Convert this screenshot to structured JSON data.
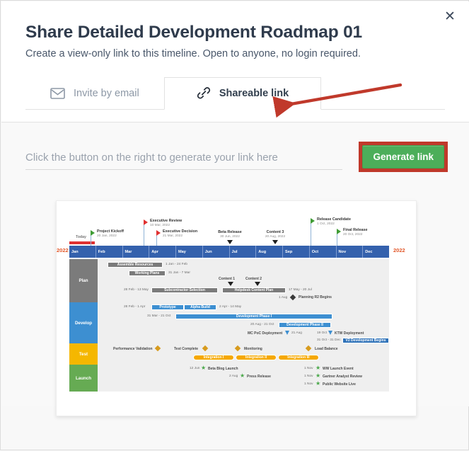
{
  "dialog": {
    "title": "Share Detailed Development Roadmap 01",
    "subtitle": "Create a view-only link to this timeline. Open to anyone, no login required.",
    "close_label": "✕"
  },
  "tabs": [
    {
      "label": "Invite by email",
      "icon": "envelope-icon",
      "active": false
    },
    {
      "label": "Shareable link",
      "icon": "link-chain-icon",
      "active": true
    }
  ],
  "share": {
    "input_value": "",
    "input_placeholder": "Click the button on the right to generate your link here",
    "generate_label": "Generate link",
    "generate_color": "#4cae5a",
    "highlight_color": "#c0392b"
  },
  "timeline": {
    "year_left": "2022",
    "year_right": "2022",
    "today_label": "Today",
    "months": [
      "Jan",
      "Feb",
      "Mar",
      "Apr",
      "May",
      "Jun",
      "Jul",
      "Aug",
      "Sep",
      "Oct",
      "Nov",
      "Dec"
    ],
    "milestones": [
      {
        "name": "Project Kickoff",
        "date": "20 Jan, 2022",
        "marker": "flag-green"
      },
      {
        "name": "Executive Review",
        "date": "10 Mar, 2022",
        "marker": "flag-red"
      },
      {
        "name": "Executive Decision",
        "date": "21 Mar, 2022",
        "marker": "flag-red"
      },
      {
        "name": "Beta Release",
        "date": "30 Jun, 2022",
        "marker": "triangle-black"
      },
      {
        "name": "Content 3",
        "date": "20 Aug, 2022",
        "marker": "triangle-black"
      },
      {
        "name": "Release Candidate",
        "date": "1 Oct, 2022",
        "marker": "flag-green"
      },
      {
        "name": "Final Release",
        "date": "20 Oct, 2022",
        "marker": "flag-green"
      }
    ],
    "lanes": [
      {
        "name": "Plan",
        "color": "#7b7b7b",
        "bars": [
          {
            "label": "Assemble Resources",
            "dates": "1 Jan - 24 Feb"
          },
          {
            "label": "Working Plans",
            "dates": "31 Jan - 7 Mar"
          },
          {
            "label": "Subcontractor Selection",
            "dates": "28 Feb - 13 May"
          },
          {
            "label": "Helpdesk Content Plan",
            "dates": "17 May - 20 Jul"
          }
        ],
        "markers": [
          {
            "label": "Content 1"
          },
          {
            "label": "Content 2"
          },
          {
            "label": "Planning R2 Begins",
            "dates": "1 Aug"
          }
        ]
      },
      {
        "name": "Develop",
        "color": "#3d8fd1",
        "bars": [
          {
            "label": "Prototype",
            "dates": "28 Feb - 1 Apr"
          },
          {
            "label": "Alpha Build",
            "dates": "2 Apr - 14 May"
          },
          {
            "label": "Development Phase I",
            "dates": "31 Mar - 21 Oct"
          },
          {
            "label": "Development Phase II",
            "dates": "20 Aug - 21 Oct"
          },
          {
            "label": "V2 Development Begins",
            "dates": "31 Oct - 31 Dec"
          }
        ],
        "markers": [
          {
            "label": "MC PoC Deployment",
            "dates": "21 Aug"
          },
          {
            "label": "KTW Deployment",
            "dates": "19 Oct"
          }
        ]
      },
      {
        "name": "Test",
        "color": "#f5b700",
        "bars": [
          {
            "label": "Integration I",
            "dates": ""
          },
          {
            "label": "Integration II",
            "dates": ""
          },
          {
            "label": "Integration III",
            "dates": ""
          }
        ],
        "markers": [
          {
            "label": "Performance Validation"
          },
          {
            "label": "Test Complete"
          },
          {
            "label": "Monitoring"
          },
          {
            "label": "Load Balance"
          }
        ]
      },
      {
        "name": "Launch",
        "color": "#66ab53",
        "bars": [],
        "markers": [
          {
            "label": "Beta Blog Launch",
            "dates": "12 Jun"
          },
          {
            "label": "Press Release",
            "dates": "2 Aug"
          },
          {
            "label": "WW Launch Event",
            "dates": "1 Nov"
          },
          {
            "label": "Gartner Analyst Review",
            "dates": "1 Nov"
          },
          {
            "label": "Public Website Live",
            "dates": "1 Nov"
          }
        ]
      }
    ]
  }
}
